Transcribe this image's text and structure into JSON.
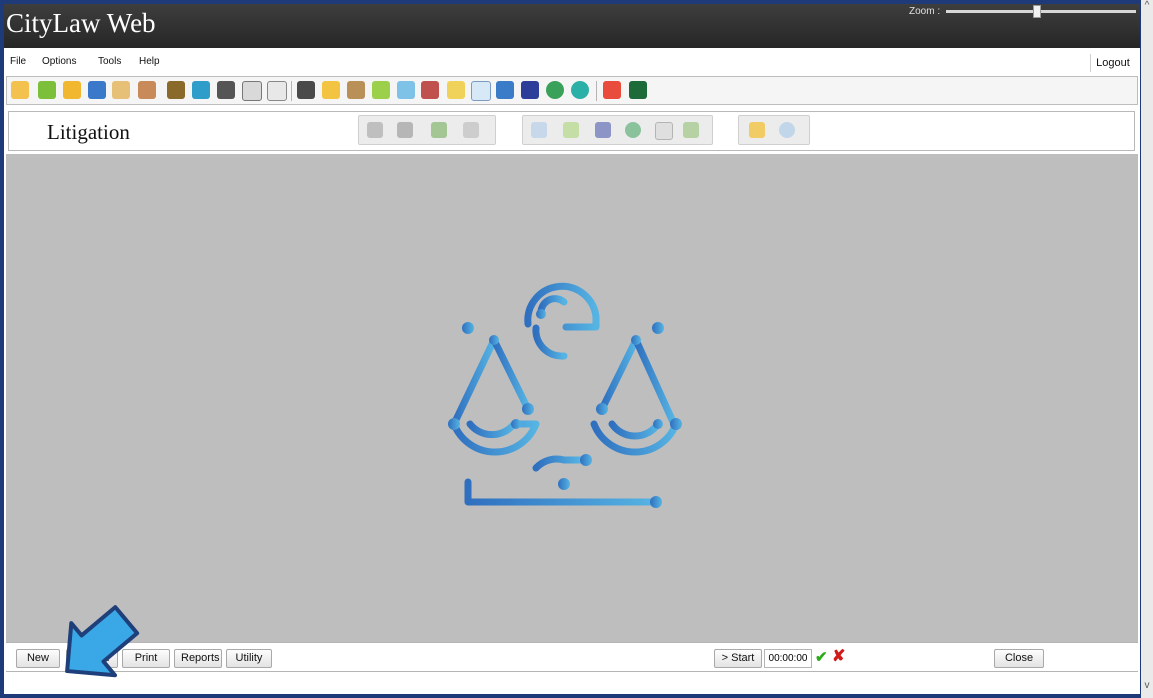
{
  "app": {
    "title": "CityLaw Web"
  },
  "zoom": {
    "label": "Zoom :",
    "level": 0.48
  },
  "menu": {
    "items": [
      "File",
      "Options",
      "Tools",
      "Help"
    ],
    "logout": "Logout"
  },
  "toolbar": {
    "icons": [
      "gavel-icon",
      "book-icon",
      "folder-icon",
      "lock-icon",
      "hands-icon",
      "handshake-icon",
      "money-bag-icon",
      "pen-icon",
      "tools-icon",
      "stopwatch-icon",
      "clock-icon",
      "printer-icon",
      "open-folder-icon",
      "book-open-icon",
      "pencil-icon",
      "eraser-icon",
      "person-icon",
      "notepad-icon",
      "magnifier-doc-icon",
      "address-book-icon",
      "arrows-icon",
      "globe-icon",
      "history-icon",
      "grid-icon",
      "m-icon"
    ]
  },
  "module": {
    "title": "Litigation"
  },
  "bottom": {
    "new": "New",
    "search": "Search",
    "print": "Print",
    "reports": "Reports",
    "utility": "Utility",
    "start": "> Start",
    "timer": "00:00:00",
    "close": "Close"
  },
  "colors": {
    "titlebar": "#2d2d2d",
    "workspace": "#bebebe",
    "logo_start": "#2f6fbf",
    "logo_end": "#56b4e3",
    "pointer": "#3aa7e6"
  }
}
